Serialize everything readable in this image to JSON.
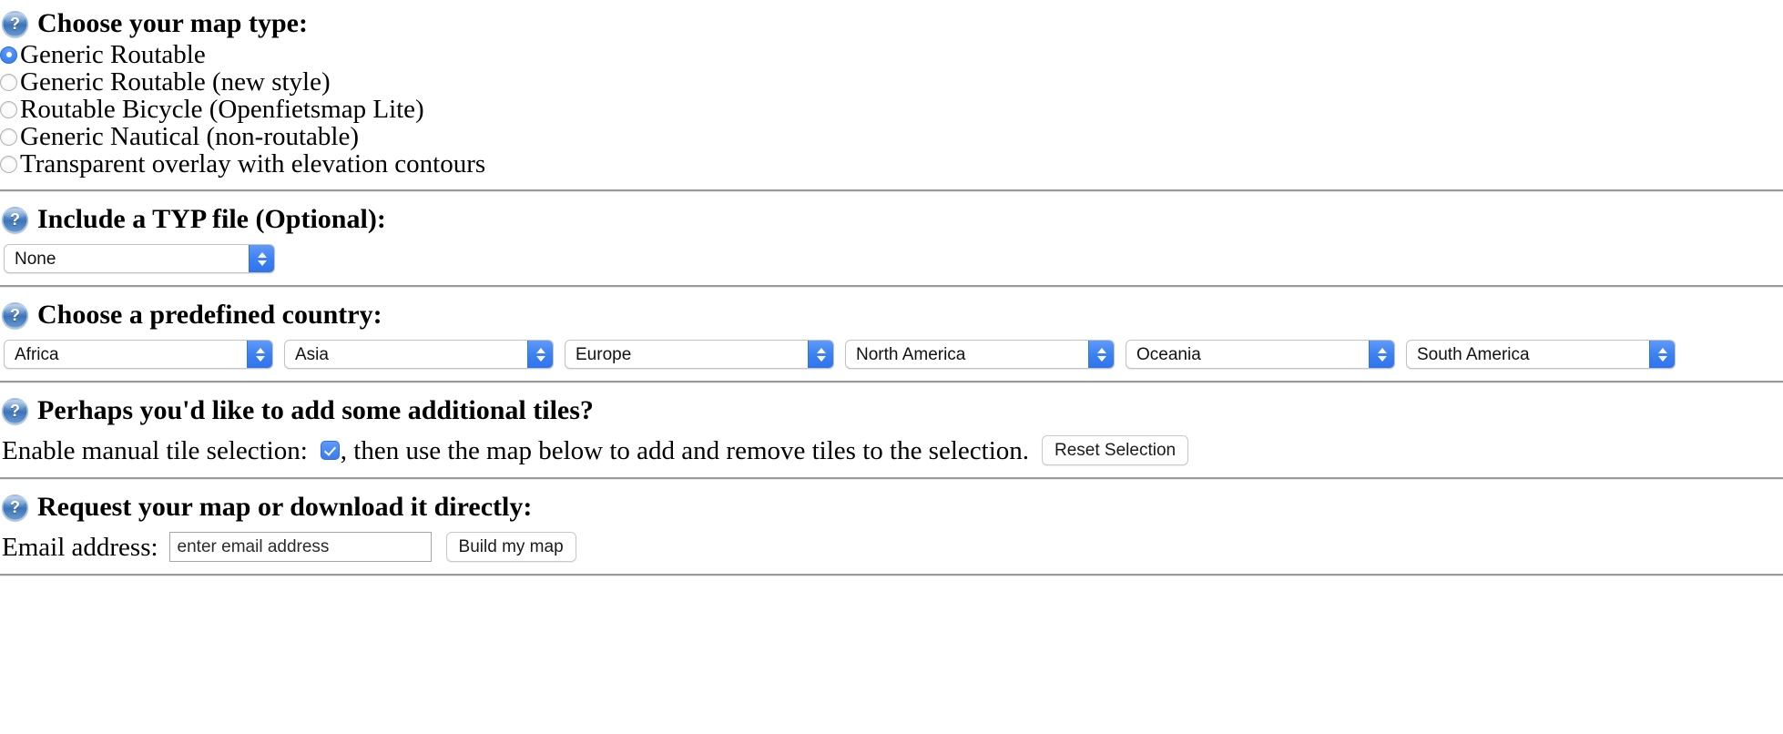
{
  "map_type": {
    "icon": "help-question-icon",
    "heading": "Choose your map type:",
    "options": [
      {
        "label": "Generic Routable",
        "selected": true
      },
      {
        "label": "Generic Routable (new style)",
        "selected": false
      },
      {
        "label": "Routable Bicycle (Openfietsmap Lite)",
        "selected": false
      },
      {
        "label": "Generic Nautical (non-routable)",
        "selected": false
      },
      {
        "label": "Transparent overlay with elevation contours",
        "selected": false
      }
    ]
  },
  "typ_file": {
    "icon": "help-question-icon",
    "heading": "Include a TYP file (Optional):",
    "select": {
      "value": "None"
    }
  },
  "country": {
    "icon": "help-question-icon",
    "heading": "Choose a predefined country:",
    "selects": [
      {
        "value": "Africa"
      },
      {
        "value": "Asia"
      },
      {
        "value": "Europe"
      },
      {
        "value": "North America"
      },
      {
        "value": "Oceania"
      },
      {
        "value": "South America"
      }
    ]
  },
  "tiles": {
    "icon": "help-question-icon",
    "heading": "Perhaps you'd like to add some additional tiles?",
    "enable_label": "Enable manual tile selection:",
    "enabled": true,
    "after_checkbox_text": ", then use the map below to add and remove tiles to the selection.",
    "reset_button": "Reset Selection"
  },
  "request": {
    "icon": "help-question-icon",
    "heading": "Request your map or download it directly:",
    "email_label": "Email address:",
    "email_value": "",
    "email_placeholder": "enter email address",
    "build_button": "Build my map"
  },
  "colors": {
    "accent_blue": "#3d82f2",
    "radio_selected": "#2f7cf6",
    "checkbox_blue": "#4a8af5",
    "divider_gray": "#9a9a9a"
  }
}
